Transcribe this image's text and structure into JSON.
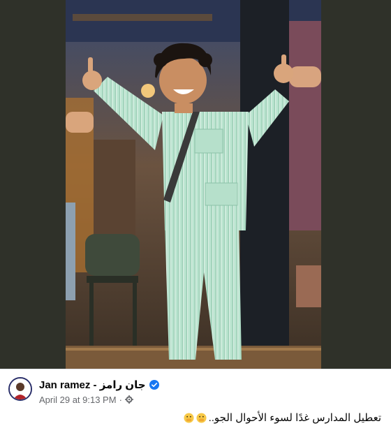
{
  "post": {
    "author_name": "Jan ramez - جان رامز",
    "timestamp": "April 29 at 9:13 PM",
    "separator": "·",
    "audience_icon": "gear-icon",
    "verified_icon": "verified-badge-icon",
    "caption_text": "تعطيل المدارس غدًا لسوء الأحوال الجو..",
    "caption_emojis": [
      "face-with-hand-over-mouth-emoji",
      "face-with-hand-over-mouth-emoji"
    ]
  },
  "colors": {
    "verified": "#1877f2",
    "meta_text": "#65676b",
    "photo_side_bg": "#2f3129",
    "pajama": "#a9d8c1"
  }
}
